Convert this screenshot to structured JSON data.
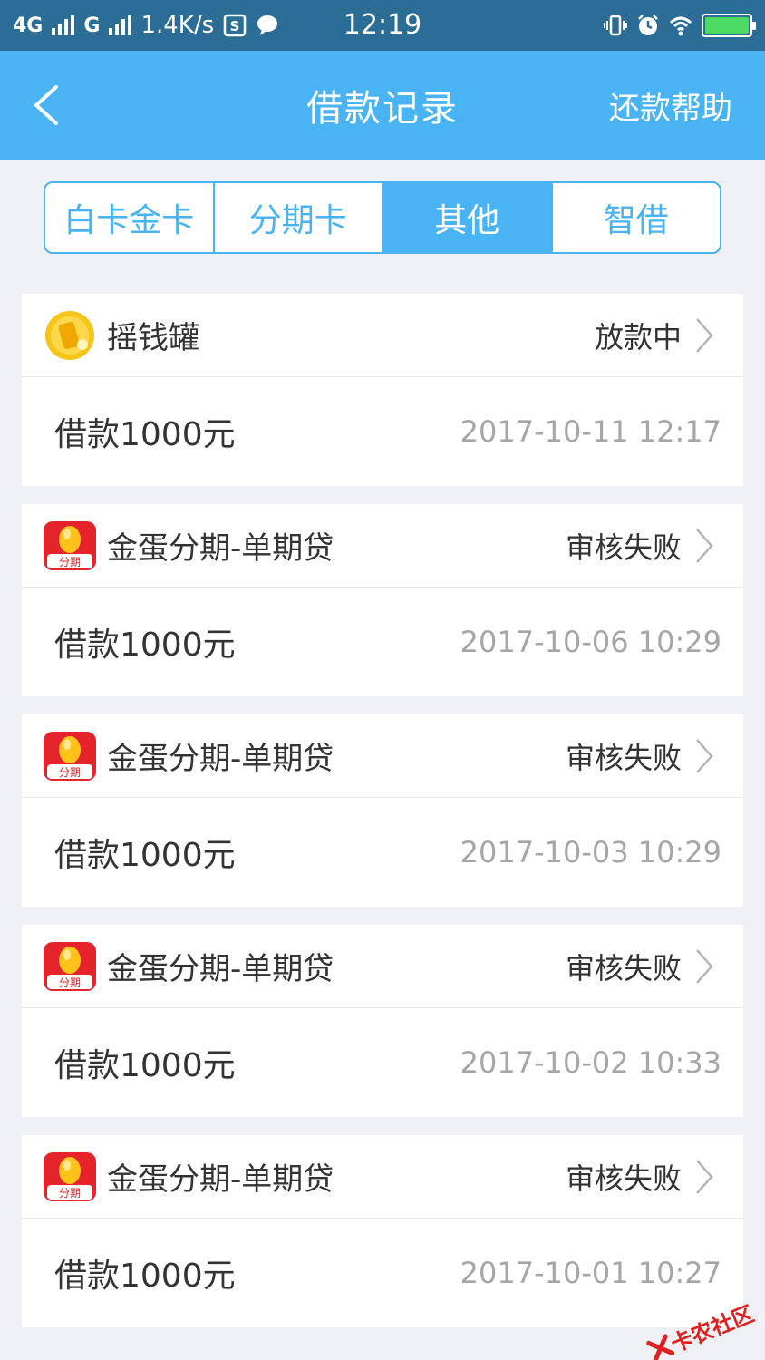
{
  "status_bar": {
    "network1": "4G",
    "network2": "G",
    "speed": "1.4K/s",
    "time": "12:19"
  },
  "header": {
    "title": "借款记录",
    "help_label": "还款帮助",
    "back_icon": "chevron-left-icon"
  },
  "tabs": [
    {
      "label": "白卡金卡",
      "active": false
    },
    {
      "label": "分期卡",
      "active": false
    },
    {
      "label": "其他",
      "active": true
    },
    {
      "label": "智借",
      "active": false
    }
  ],
  "records": [
    {
      "name": "摇钱罐",
      "logo": "coin-jar-icon",
      "status": "放款中",
      "amount": "借款1000元",
      "time": "2017-10-11 12:17"
    },
    {
      "name": "金蛋分期-单期贷",
      "logo": "golden-egg-icon",
      "logo_text": "分期",
      "status": "审核失败",
      "amount": "借款1000元",
      "time": "2017-10-06 10:29"
    },
    {
      "name": "金蛋分期-单期贷",
      "logo": "golden-egg-icon",
      "logo_text": "分期",
      "status": "审核失败",
      "amount": "借款1000元",
      "time": "2017-10-03 10:29"
    },
    {
      "name": "金蛋分期-单期贷",
      "logo": "golden-egg-icon",
      "logo_text": "分期",
      "status": "审核失败",
      "amount": "借款1000元",
      "time": "2017-10-02 10:33"
    },
    {
      "name": "金蛋分期-单期贷",
      "logo": "golden-egg-icon",
      "logo_text": "分期",
      "status": "审核失败",
      "amount": "借款1000元",
      "time": "2017-10-01 10:27"
    }
  ],
  "watermark": {
    "text": "卡农社区"
  },
  "colors": {
    "header": "#4ab3f3",
    "status_bar": "#2c6d96",
    "background": "#eef0f3"
  }
}
